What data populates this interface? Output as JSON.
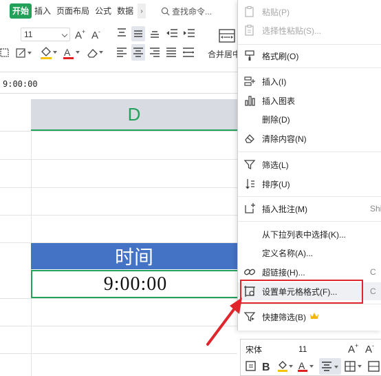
{
  "ribbon": {
    "tabs": [
      {
        "label": "开始",
        "active": true
      },
      {
        "label": "插入"
      },
      {
        "label": "页面布局"
      },
      {
        "label": "公式"
      },
      {
        "label": "数据"
      }
    ],
    "more_tabs_glyph": "›",
    "search_placeholder": "查找命令...",
    "font_size": "11",
    "merge_label": "合并居中"
  },
  "formula_bar": {
    "value": "9:00:00"
  },
  "sheet": {
    "column_header": "D",
    "header_cell": "时间",
    "selected_cell": "9:00:00"
  },
  "context_menu": {
    "items": [
      {
        "label": "粘贴(P)",
        "icon": "paste-icon",
        "disabled": true
      },
      {
        "label": "选择性粘贴(S)...",
        "icon": "paste-special-icon",
        "disabled": true
      },
      {
        "label": "格式刷(O)",
        "icon": "format-painter-icon"
      },
      {
        "label": "插入(I)",
        "icon": "insert-icon"
      },
      {
        "label": "插入图表",
        "icon": "chart-icon"
      },
      {
        "label": "删除(D)",
        "icon": ""
      },
      {
        "label": "清除内容(N)",
        "icon": "eraser-icon"
      },
      {
        "label": "筛选(L)",
        "icon": "filter-icon"
      },
      {
        "label": "排序(U)",
        "icon": "sort-icon"
      },
      {
        "label": "插入批注(M)",
        "icon": "comment-icon",
        "shortcut": "Shi"
      },
      {
        "label": "从下拉列表中选择(K)...",
        "icon": ""
      },
      {
        "label": "定义名称(A)...",
        "icon": ""
      },
      {
        "label": "超链接(H)...",
        "icon": "link-icon",
        "shortcut": "C"
      },
      {
        "label": "设置单元格格式(F)...",
        "icon": "format-cells-icon",
        "shortcut": "C"
      },
      {
        "label": "快捷筛选(B)",
        "icon": "quick-filter-icon",
        "badge": "crown-icon"
      }
    ]
  },
  "mini_toolbar": {
    "font_name": "宋体",
    "font_size": "11"
  },
  "colors": {
    "accent_green": "#22a15a",
    "header_blue": "#4472c4",
    "highlight_red": "#e0262d"
  }
}
